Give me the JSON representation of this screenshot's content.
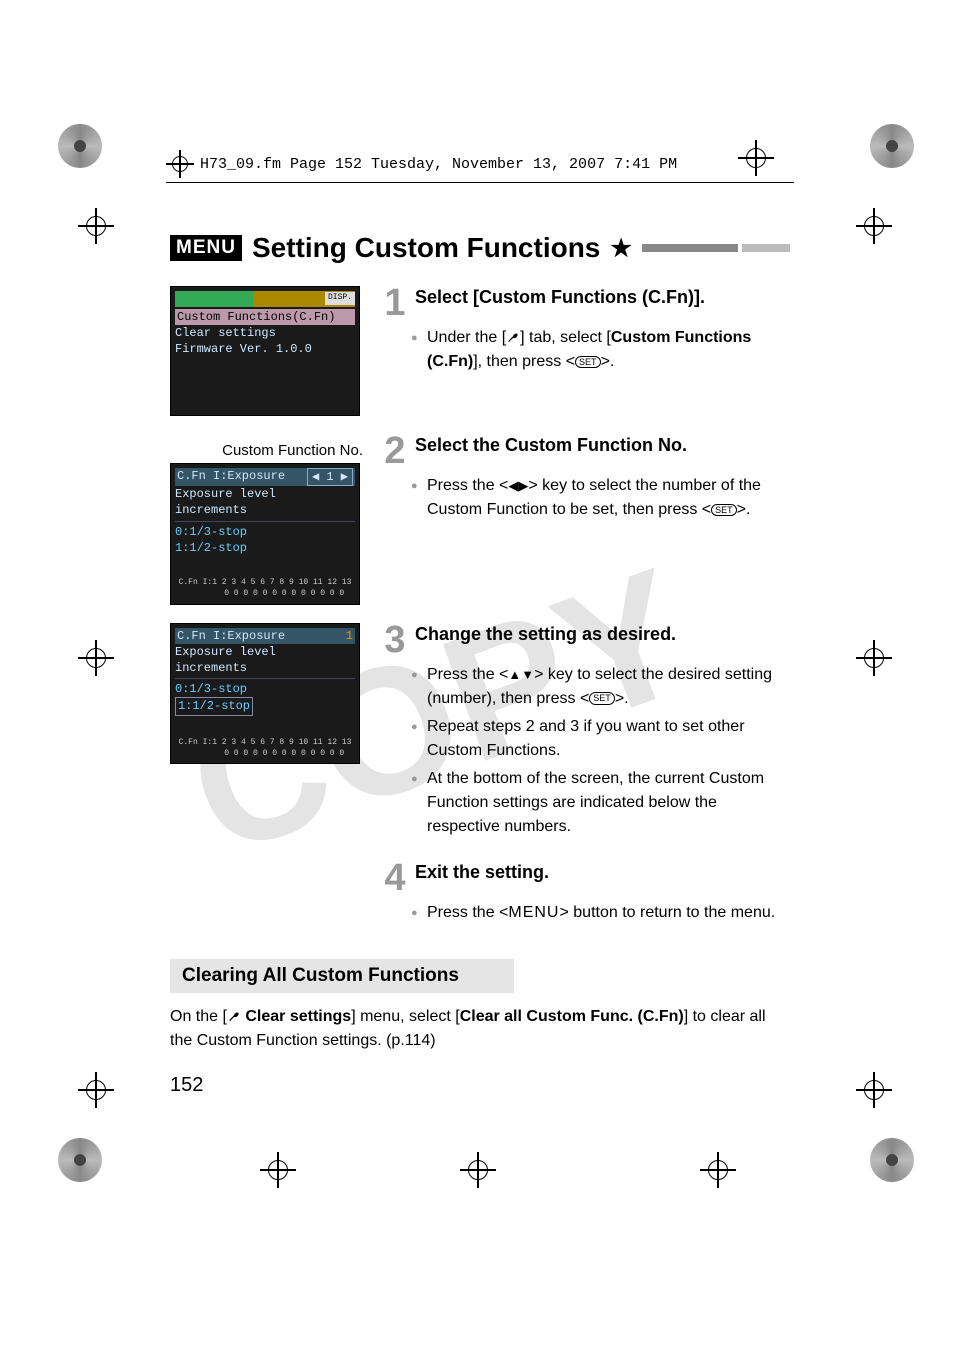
{
  "header_crop": "H73_09.fm  Page 152  Tuesday, November 13, 2007  7:41 PM",
  "heading": {
    "menu_badge": "MENU",
    "text": "Setting Custom Functions"
  },
  "lcd1": {
    "disp": "DISP.",
    "line1": "Custom Functions(C.Fn)",
    "line2": "Clear settings",
    "line3": "Firmware Ver. 1.0.0"
  },
  "cfn_caption": "Custom Function No.",
  "lcd2": {
    "header": "C.Fn I:Exposure",
    "sub": "Exposure level increments",
    "opt1": "0:1/3-stop",
    "opt2": "1:1/2-stop",
    "footer_label": "C.Fn  I:",
    "footer_nums_top": "1 2 3 4 5 6 7 8 9 10 11 12 13",
    "footer_nums_bot": "0 0 0 0 0 0 0 0 0  0  0  0  0"
  },
  "lcd3": {
    "header": "C.Fn I:Exposure",
    "header_num": "1",
    "sub": "Exposure level increments",
    "opt1": "0:1/3-stop",
    "opt2": "1:1/2-stop",
    "footer_label": "C.Fn  I:",
    "footer_nums_top": "1 2 3 4 5 6 7 8 9 10 11 12 13",
    "footer_nums_bot": "0 0 0 0 0 0 0 0 0  0  0  0  0"
  },
  "steps": {
    "s1": {
      "num": "1",
      "title": "Select [Custom Functions (C.Fn)].",
      "b1a": "Under the [",
      "b1b": "] tab, select [",
      "b1c": "Custom Functions (C.Fn)",
      "b1d": "], then press <",
      "b1e": ">."
    },
    "s2": {
      "num": "2",
      "title": "Select the Custom Function No.",
      "b1a": "Press the <",
      "b1b": "> key to select the number of the Custom Function to be set, then press <",
      "b1c": ">."
    },
    "s3": {
      "num": "3",
      "title": "Change the setting as desired.",
      "b1a": "Press the <",
      "b1b": "> key to select the desired setting (number), then press <",
      "b1c": ">.",
      "b2": "Repeat steps 2 and 3 if you want to set other Custom Functions.",
      "b3": "At the bottom of the screen, the current Custom Function settings are indicated below the respective numbers."
    },
    "s4": {
      "num": "4",
      "title": "Exit the setting.",
      "b1a": "Press the <",
      "b1b": "MENU",
      "b1c": "> button to return to the menu."
    }
  },
  "clearing": {
    "heading": "Clearing All Custom Functions",
    "body_a": "On the [",
    "body_b": " Clear settings",
    "body_c": "] menu, select [",
    "body_d": "Clear all Custom Func. (C.Fn)",
    "body_e": "] to clear all the Custom Function settings. (p.114)"
  },
  "page_number": "152",
  "icons": {
    "set": "SET",
    "lr": "◀▶",
    "ud": "▲▼",
    "wrench": "wrench"
  }
}
